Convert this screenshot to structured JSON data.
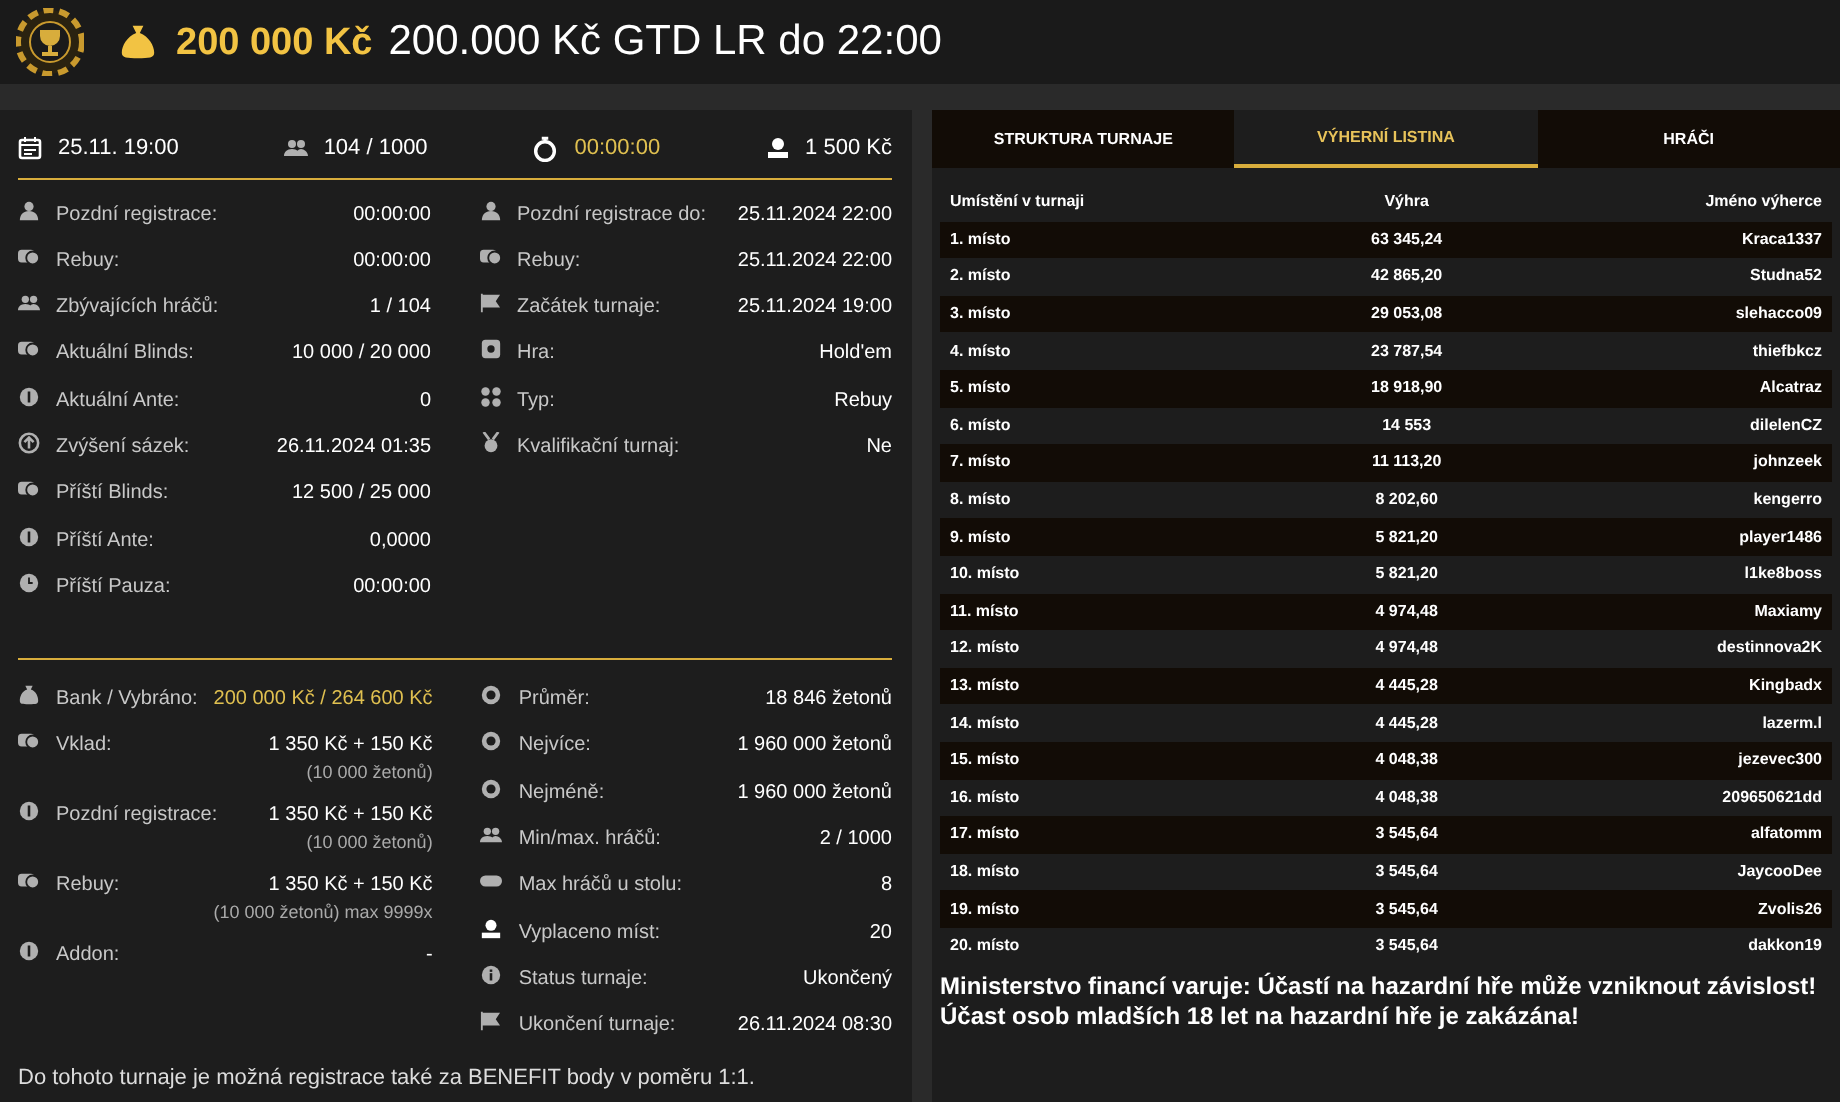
{
  "header": {
    "prize": "200 000 Kč",
    "title": "200.000 Kč GTD LR do 22:00"
  },
  "summary": [
    {
      "text": "25.11. 19:00",
      "highlight": false
    },
    {
      "text": "104 / 1000",
      "highlight": false
    },
    {
      "text": "00:00:00",
      "highlight": true
    },
    {
      "text": "1 500 Kč",
      "highlight": false
    }
  ],
  "details_left": [
    {
      "label": "Pozdní registrace:",
      "value": "00:00:00"
    },
    {
      "label": "Rebuy:",
      "value": "00:00:00"
    },
    {
      "label": "Zbývajících hráčů:",
      "value": "1 / 104"
    },
    {
      "label": "Aktuální Blinds:",
      "value": "10 000 / 20 000"
    },
    {
      "label": "Aktuální Ante:",
      "value": "0"
    },
    {
      "label": "Zvýšení sázek:",
      "value": "26.11.2024 01:35"
    },
    {
      "label": "Příští Blinds:",
      "value": "12 500 / 25 000"
    },
    {
      "label": "Příští Ante:",
      "value": "0,0000"
    },
    {
      "label": "Příští Pauza:",
      "value": "00:00:00"
    }
  ],
  "details_right": [
    {
      "label": "Pozdní registrace do:",
      "value": "25.11.2024 22:00"
    },
    {
      "label": "Rebuy:",
      "value": "25.11.2024 22:00"
    },
    {
      "label": "Začátek turnaje:",
      "value": "25.11.2024 19:00"
    },
    {
      "label": "Hra:",
      "value": "Hold'em"
    },
    {
      "label": "Typ:",
      "value": "Rebuy"
    },
    {
      "label": "Kvalifikační turnaj:",
      "value": "Ne"
    }
  ],
  "money_left": [
    {
      "label": "Bank / Vybráno:",
      "value": "200 000 Kč / 264 600 Kč",
      "highlight": true
    },
    {
      "label": "Vklad:",
      "value": "1 350 Kč + 150 Kč",
      "note": "(10 000 žetonů)",
      "highlight": false
    },
    {
      "label": "Pozdní registrace:",
      "value": "1 350 Kč + 150 Kč",
      "note": "(10 000 žetonů)",
      "highlight": false
    },
    {
      "label": "Rebuy:",
      "value": "1 350 Kč + 150 Kč",
      "note": "(10 000 žetonů) max 9999x",
      "highlight": false
    },
    {
      "label": "Addon:",
      "value": "-",
      "highlight": false
    }
  ],
  "money_right": [
    {
      "label": "Průměr:",
      "value": "18 846 žetonů"
    },
    {
      "label": "Nejvíce:",
      "value": "1 960 000 žetonů"
    },
    {
      "label": "Nejméně:",
      "value": "1 960 000 žetonů"
    },
    {
      "label": "Min/max. hráčů:",
      "value": "2 / 1000"
    },
    {
      "label": "Max hráčů u stolu:",
      "value": "8"
    },
    {
      "label": "Vyplaceno míst:",
      "value": "20"
    },
    {
      "label": "Status turnaje:",
      "value": "Ukončený"
    },
    {
      "label": "Ukončení turnaje:",
      "value": "26.11.2024 08:30"
    }
  ],
  "footnote": "Do tohoto turnaje je možná registrace také za BENEFIT body v poměru 1:1.",
  "tabs": [
    {
      "label": "STRUKTURA TURNAJE",
      "selected": false
    },
    {
      "label": "VÝHERNÍ LISTINA",
      "selected": true
    },
    {
      "label": "HRÁČI",
      "selected": false
    }
  ],
  "table": {
    "columns": [
      "Umístění v turnaji",
      "Výhra",
      "Jméno výherce"
    ],
    "rows": [
      [
        "1. místo",
        "63 345,24",
        "Kraca1337"
      ],
      [
        "2. místo",
        "42 865,20",
        "Studna52"
      ],
      [
        "3. místo",
        "29 053,08",
        "slehacco09"
      ],
      [
        "4. místo",
        "23 787,54",
        "thiefbkcz"
      ],
      [
        "5. místo",
        "18 918,90",
        "Alcatraz"
      ],
      [
        "6. místo",
        "14 553",
        "dilelenCZ"
      ],
      [
        "7. místo",
        "11 113,20",
        "johnzeek"
      ],
      [
        "8. místo",
        "8 202,60",
        "kengerro"
      ],
      [
        "9. místo",
        "5 821,20",
        "player1486"
      ],
      [
        "10. místo",
        "5 821,20",
        "l1ke8boss"
      ],
      [
        "11. místo",
        "4 974,48",
        "Maxiamy"
      ],
      [
        "12. místo",
        "4 974,48",
        "destinnova2K"
      ],
      [
        "13. místo",
        "4 445,28",
        "Kingbadx"
      ],
      [
        "14. místo",
        "4 445,28",
        "lazerm.l"
      ],
      [
        "15. místo",
        "4 048,38",
        "jezevec300"
      ],
      [
        "16. místo",
        "4 048,38",
        "209650621dd"
      ],
      [
        "17. místo",
        "3 545,64",
        "alfatomm"
      ],
      [
        "18. místo",
        "3 545,64",
        "JaycooDee"
      ],
      [
        "19. místo",
        "3 545,64",
        "Zvolis26"
      ],
      [
        "20. místo",
        "3 545,64",
        "dakkon19"
      ]
    ]
  },
  "warning": [
    "Ministerstvo financí varuje: Účastí na hazardní hře může vzniknout závislost!",
    "Účast osob mladších 18 let na hazardní hře je zakázána!"
  ]
}
